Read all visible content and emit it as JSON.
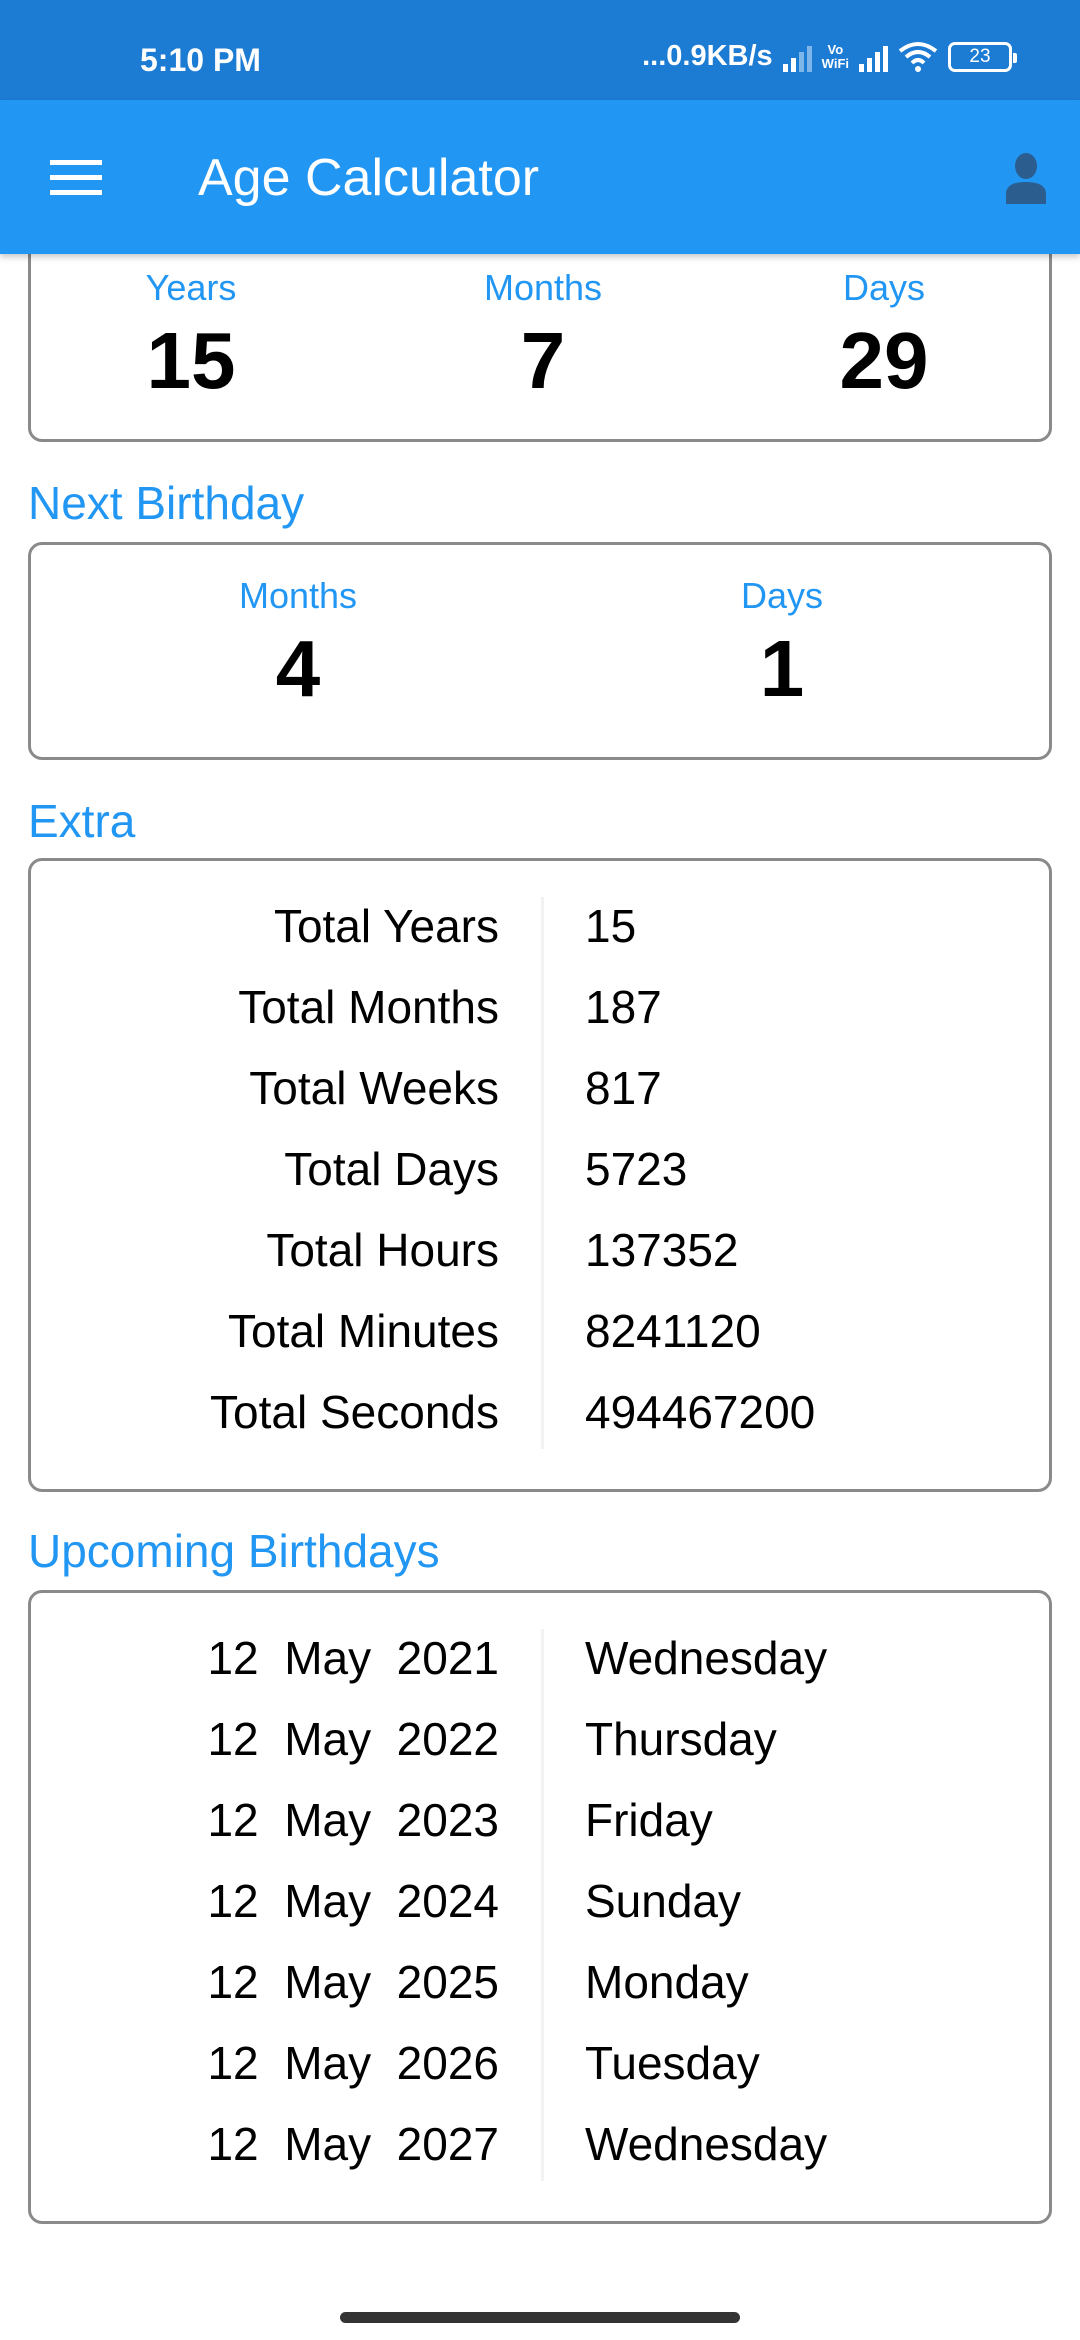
{
  "status_bar": {
    "time": "5:10 PM",
    "network_speed": "...0.9KB/s",
    "vowifi_top": "Vo",
    "vowifi_bottom": "WiFi",
    "battery_level": "23",
    "icons": [
      "signal-icon",
      "vowifi-icon",
      "signal-icon",
      "wifi-icon",
      "battery-icon"
    ]
  },
  "app_bar": {
    "title": "Age Calculator",
    "menu_icon": "hamburger-menu-icon",
    "account_icon": "account-icon"
  },
  "age": {
    "items": [
      {
        "label": "Years",
        "value": "15"
      },
      {
        "label": "Months",
        "value": "7"
      },
      {
        "label": "Days",
        "value": "29"
      }
    ]
  },
  "next_birthday": {
    "title": "Next Birthday",
    "items": [
      {
        "label": "Months",
        "value": "4"
      },
      {
        "label": "Days",
        "value": "1"
      }
    ]
  },
  "extra": {
    "title": "Extra",
    "rows": [
      {
        "label": "Total Years",
        "value": "15"
      },
      {
        "label": "Total Months",
        "value": "187"
      },
      {
        "label": "Total Weeks",
        "value": "817"
      },
      {
        "label": "Total Days",
        "value": "5723"
      },
      {
        "label": "Total Hours",
        "value": "137352"
      },
      {
        "label": "Total Minutes",
        "value": "8241120"
      },
      {
        "label": "Total Seconds",
        "value": "494467200"
      }
    ]
  },
  "upcoming_birthdays": {
    "title": "Upcoming Birthdays",
    "rows": [
      {
        "date": "12  May  2021",
        "weekday": "Wednesday"
      },
      {
        "date": "12  May  2022",
        "weekday": "Thursday"
      },
      {
        "date": "12  May  2023",
        "weekday": "Friday"
      },
      {
        "date": "12  May  2024",
        "weekday": "Sunday"
      },
      {
        "date": "12  May  2025",
        "weekday": "Monday"
      },
      {
        "date": "12  May  2026",
        "weekday": "Tuesday"
      },
      {
        "date": "12  May  2027",
        "weekday": "Wednesday"
      }
    ]
  },
  "colors": {
    "status_bar": "#1c7bd3",
    "app_bar": "#2196f3",
    "accent": "#2196f3",
    "card_border": "#8a8a8a"
  }
}
